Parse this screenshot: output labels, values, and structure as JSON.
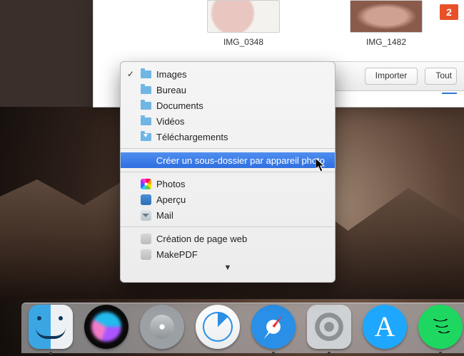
{
  "badge": "2",
  "thumbnails": [
    {
      "name": "IMG_0348"
    },
    {
      "name": "IMG_1482"
    }
  ],
  "toolbar": {
    "import_label": "Importer",
    "all_label": "Tout"
  },
  "dropdown": {
    "sections": [
      [
        {
          "label": "Images",
          "icon": "folder",
          "checked": true
        },
        {
          "label": "Bureau",
          "icon": "folder"
        },
        {
          "label": "Documents",
          "icon": "folder"
        },
        {
          "label": "Vidéos",
          "icon": "folder"
        },
        {
          "label": "Téléchargements",
          "icon": "folder-download"
        }
      ],
      [
        {
          "label": "Créer un sous-dossier par appareil photo",
          "highlighted": true
        }
      ],
      [
        {
          "label": "Photos",
          "icon": "app-photos"
        },
        {
          "label": "Aperçu",
          "icon": "app-preview"
        },
        {
          "label": "Mail",
          "icon": "app-mail"
        }
      ],
      [
        {
          "label": "Création de page web",
          "icon": "app-generic"
        },
        {
          "label": "MakePDF",
          "icon": "app-generic"
        }
      ]
    ]
  },
  "dock": [
    "finder",
    "siri",
    "launchpad",
    "mail",
    "safari",
    "settings",
    "appstore",
    "spotify"
  ],
  "dock_active": [
    "finder",
    "safari",
    "settings",
    "spotify"
  ]
}
